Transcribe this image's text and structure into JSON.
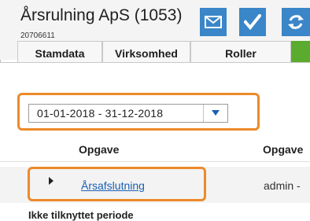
{
  "header": {
    "title": "Årsrulning ApS (1053)",
    "company_id": "20706611"
  },
  "actions": [
    {
      "icon": "mail-icon"
    },
    {
      "icon": "checkmark-icon"
    },
    {
      "icon": "refresh-icon"
    }
  ],
  "tabs": [
    {
      "label": "Stamdata"
    },
    {
      "label": "Virksomhed"
    },
    {
      "label": "Roller"
    }
  ],
  "filter": {
    "period_value": "01-01-2018 - 31-12-2018"
  },
  "table": {
    "columns": [
      "Opgave",
      "Opgave"
    ],
    "rows": [
      {
        "task": "Årsafslutning",
        "owner": "admin -"
      }
    ]
  },
  "footer": {
    "text": "Ikke tilknyttet periode"
  },
  "colors": {
    "accent_blue": "#3a86c8",
    "highlight_orange": "#ec8a2a",
    "link_blue": "#1a5fb4",
    "tab_green": "#5aab2e"
  }
}
